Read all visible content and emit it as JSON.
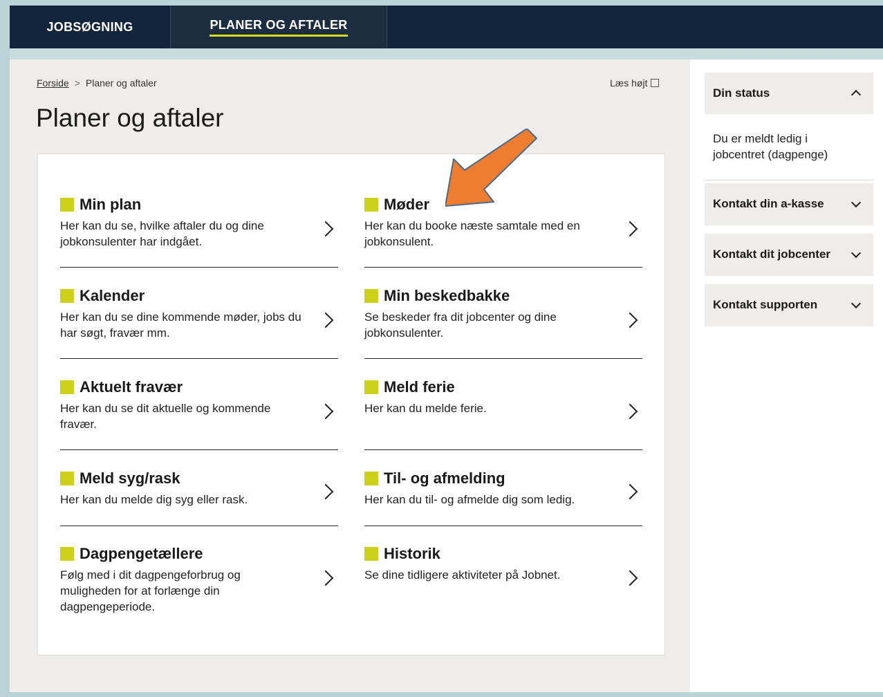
{
  "nav": {
    "tabs": [
      {
        "label": "JOBSØGNING"
      },
      {
        "label": "PLANER OG AFTALER",
        "active": true
      }
    ],
    "accent_color": "#d5dc1d"
  },
  "breadcrumb": {
    "home": "Forside",
    "separator": ">",
    "current": "Planer og aftaler"
  },
  "read_aloud": "Læs højt",
  "page_title": "Planer og aftaler",
  "items": [
    {
      "title": "Min plan",
      "desc": "Her kan du se, hvilke aftaler du og dine jobkonsulenter har indgået."
    },
    {
      "title": "Møder",
      "desc": "Her kan du booke næste samtale med en jobkonsulent."
    },
    {
      "title": "Kalender",
      "desc": "Her kan du se dine kommende møder, jobs du har søgt, fravær mm."
    },
    {
      "title": "Min beskedbakke",
      "desc": "Se beskeder fra dit jobcenter og dine jobkonsulenter."
    },
    {
      "title": "Aktuelt fravær",
      "desc": "Her kan du se dit aktuelle og kommende fravær."
    },
    {
      "title": "Meld ferie",
      "desc": "Her kan du melde ferie."
    },
    {
      "title": "Meld syg/rask",
      "desc": "Her kan du melde dig syg eller rask."
    },
    {
      "title": "Til- og afmelding",
      "desc": "Her kan du til- og afmelde dig som ledig."
    },
    {
      "title": "Dagpengetællere",
      "desc": "Følg med i dit dagpengeforbrug og muligheden for at forlænge din dagpengeperiode."
    },
    {
      "title": "Historik",
      "desc": "Se dine tidligere aktiviteter på Jobnet."
    }
  ],
  "sidebar": {
    "status": {
      "title": "Din status",
      "body": "Du er meldt ledig i jobcentret (dagpenge)",
      "expanded": true
    },
    "accordions": [
      {
        "label": "Kontakt din a-kasse"
      },
      {
        "label": "Kontakt dit jobcenter"
      },
      {
        "label": "Kontakt supporten"
      }
    ]
  },
  "colors": {
    "nav_bg": "#13253a",
    "item_square": "#cdd119",
    "annotation_arrow": "#ef7d30"
  }
}
